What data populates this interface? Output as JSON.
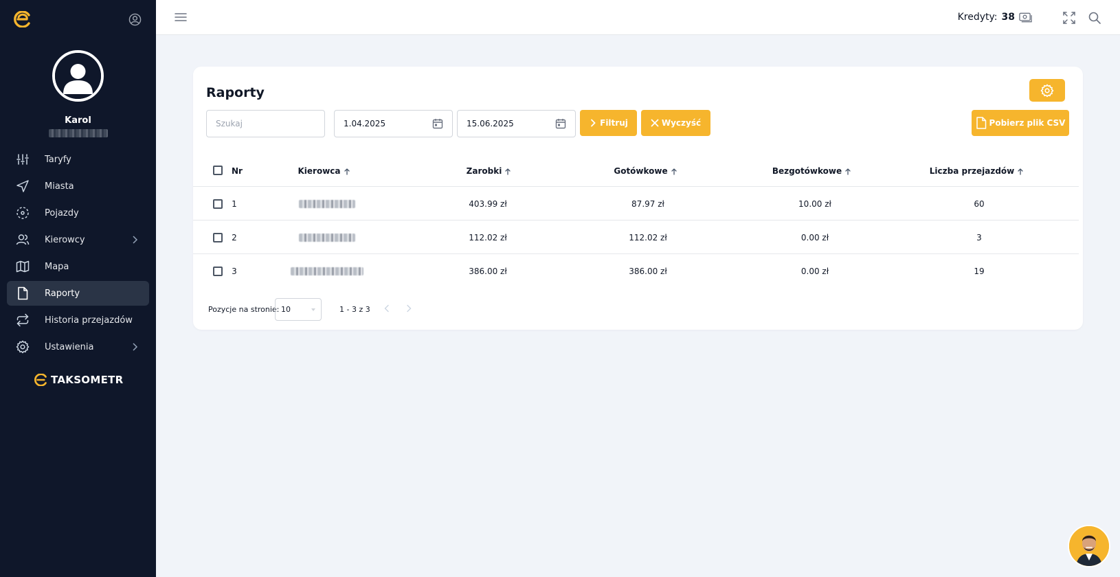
{
  "sidebar": {
    "user": {
      "name": "Karol"
    },
    "items": [
      {
        "key": "taryfy",
        "label": "Taryfy",
        "icon": "sliders-icon",
        "has_children": false,
        "active": false
      },
      {
        "key": "miasta",
        "label": "Miasta",
        "icon": "navigation-icon",
        "has_children": false,
        "active": false
      },
      {
        "key": "pojazdy",
        "label": "Pojazdy",
        "icon": "vehicle-icon",
        "has_children": false,
        "active": false
      },
      {
        "key": "kierowcy",
        "label": "Kierowcy",
        "icon": "users-icon",
        "has_children": true,
        "active": false
      },
      {
        "key": "mapa",
        "label": "Mapa",
        "icon": "map-icon",
        "has_children": false,
        "active": false
      },
      {
        "key": "raporty",
        "label": "Raporty",
        "icon": "file-icon",
        "has_children": false,
        "active": true
      },
      {
        "key": "historia",
        "label": "Historia przejazdów",
        "icon": "repeat-icon",
        "has_children": false,
        "active": false
      },
      {
        "key": "ustawienia",
        "label": "Ustawienia",
        "icon": "gear-icon",
        "has_children": true,
        "active": false
      }
    ],
    "brand": "TAKSOMETR"
  },
  "topbar": {
    "credits_label": "Kredyty:",
    "credits_value": "38"
  },
  "card": {
    "title": "Raporty",
    "search_placeholder": "Szukaj",
    "date_from": "1.04.2025",
    "date_to": "15.06.2025",
    "filter_label": "Filtruj",
    "clear_label": "Wyczyść",
    "csv_label": "Pobierz plik CSV"
  },
  "table": {
    "headers": {
      "nr": "Nr",
      "driver": "Kierowca",
      "earnings": "Zarobki",
      "cash": "Gotówkowe",
      "cashless": "Bezgotówkowe",
      "rides": "Liczba przejazdów"
    },
    "rows": [
      {
        "nr": "1",
        "earnings": "403.99 zł",
        "cash": "87.97 zł",
        "cashless": "10.00 zł",
        "rides": "60"
      },
      {
        "nr": "2",
        "earnings": "112.02 zł",
        "cash": "112.02 zł",
        "cashless": "0.00 zł",
        "rides": "3"
      },
      {
        "nr": "3",
        "earnings": "386.00 zł",
        "cash": "386.00 zł",
        "cashless": "0.00 zł",
        "rides": "19"
      }
    ]
  },
  "pagination": {
    "label": "Pozycje na stronie:",
    "page_size": "10",
    "range": "1 - 3 z 3"
  },
  "colors": {
    "accent": "#f6b52d",
    "sidebar_bg": "#0f172a",
    "sidebar_active": "#2a3446",
    "page_bg": "#f1f4f9"
  }
}
